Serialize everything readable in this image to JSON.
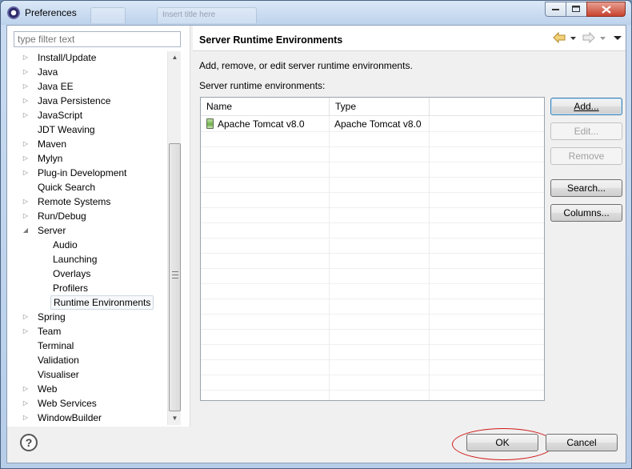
{
  "window": {
    "title": "Preferences",
    "ghost_tabs": [
      "",
      "Insert title here",
      ""
    ]
  },
  "filter": {
    "placeholder": "type filter text"
  },
  "tree": {
    "items": [
      {
        "label": "Install/Update",
        "level": 0,
        "expandable": true,
        "expanded": false
      },
      {
        "label": "Java",
        "level": 0,
        "expandable": true,
        "expanded": false
      },
      {
        "label": "Java EE",
        "level": 0,
        "expandable": true,
        "expanded": false
      },
      {
        "label": "Java Persistence",
        "level": 0,
        "expandable": true,
        "expanded": false
      },
      {
        "label": "JavaScript",
        "level": 0,
        "expandable": true,
        "expanded": false
      },
      {
        "label": "JDT Weaving",
        "level": 0,
        "expandable": false,
        "expanded": false
      },
      {
        "label": "Maven",
        "level": 0,
        "expandable": true,
        "expanded": false
      },
      {
        "label": "Mylyn",
        "level": 0,
        "expandable": true,
        "expanded": false
      },
      {
        "label": "Plug-in Development",
        "level": 0,
        "expandable": true,
        "expanded": false
      },
      {
        "label": "Quick Search",
        "level": 0,
        "expandable": false,
        "expanded": false
      },
      {
        "label": "Remote Systems",
        "level": 0,
        "expandable": true,
        "expanded": false
      },
      {
        "label": "Run/Debug",
        "level": 0,
        "expandable": true,
        "expanded": false
      },
      {
        "label": "Server",
        "level": 0,
        "expandable": true,
        "expanded": true
      },
      {
        "label": "Audio",
        "level": 1,
        "expandable": false,
        "expanded": false
      },
      {
        "label": "Launching",
        "level": 1,
        "expandable": false,
        "expanded": false
      },
      {
        "label": "Overlays",
        "level": 1,
        "expandable": false,
        "expanded": false
      },
      {
        "label": "Profilers",
        "level": 1,
        "expandable": false,
        "expanded": false
      },
      {
        "label": "Runtime Environments",
        "level": 1,
        "expandable": false,
        "expanded": false,
        "selected": true
      },
      {
        "label": "Spring",
        "level": 0,
        "expandable": true,
        "expanded": false
      },
      {
        "label": "Team",
        "level": 0,
        "expandable": true,
        "expanded": false
      },
      {
        "label": "Terminal",
        "level": 0,
        "expandable": false,
        "expanded": false
      },
      {
        "label": "Validation",
        "level": 0,
        "expandable": false,
        "expanded": false
      },
      {
        "label": "Visualiser",
        "level": 0,
        "expandable": false,
        "expanded": false
      },
      {
        "label": "Web",
        "level": 0,
        "expandable": true,
        "expanded": false
      },
      {
        "label": "Web Services",
        "level": 0,
        "expandable": true,
        "expanded": false
      },
      {
        "label": "WindowBuilder",
        "level": 0,
        "expandable": true,
        "expanded": false
      }
    ]
  },
  "page": {
    "title": "Server Runtime Environments",
    "description": "Add, remove, or edit server runtime environments.",
    "list_label": "Server runtime environments:",
    "columns": [
      "Name",
      "Type"
    ],
    "rows": [
      {
        "name": "Apache Tomcat v8.0",
        "type": "Apache Tomcat v8.0",
        "icon": "server-icon"
      }
    ]
  },
  "buttons": {
    "add": "Add...",
    "edit": "Edit...",
    "remove": "Remove",
    "search": "Search...",
    "columns": "Columns...",
    "ok": "OK",
    "cancel": "Cancel",
    "help": "?"
  },
  "colors": {
    "annotation_circle": "#d01818",
    "default_button_border": "#3c7fb1"
  }
}
